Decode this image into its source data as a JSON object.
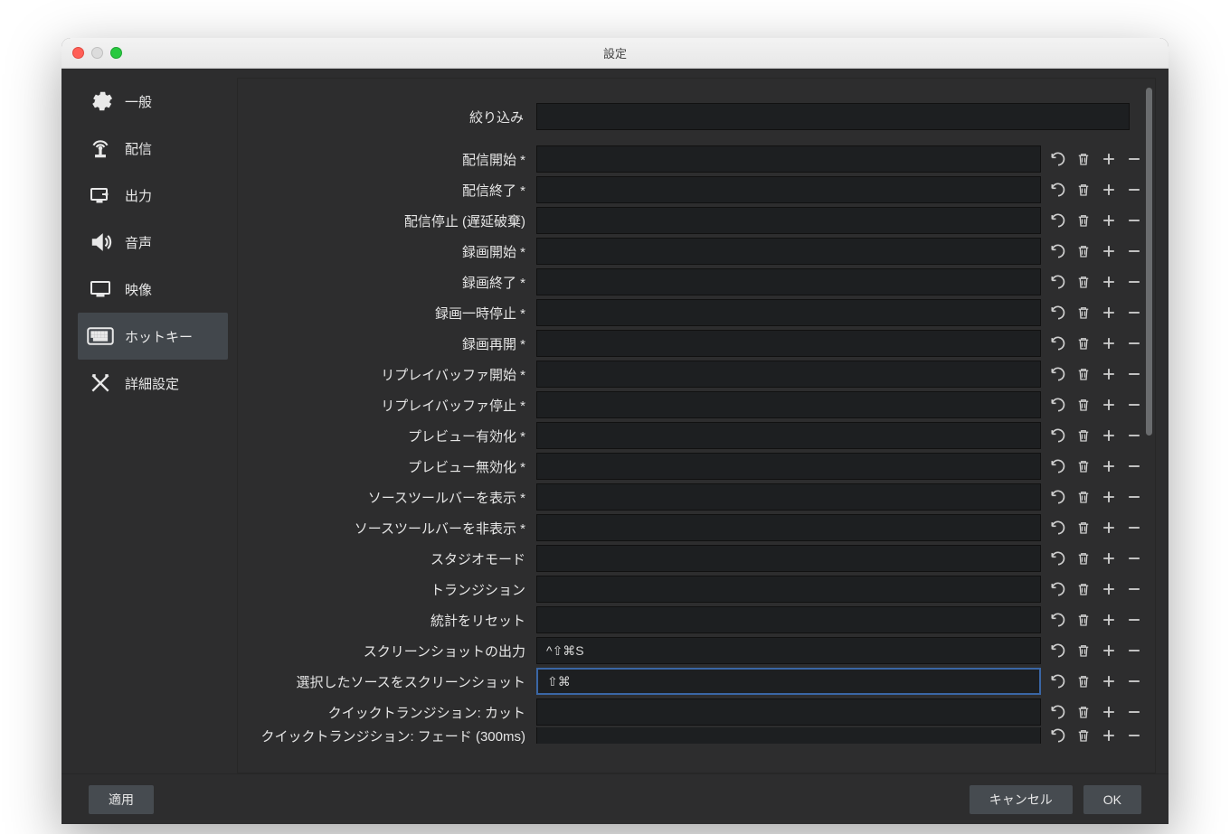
{
  "window": {
    "title": "設定"
  },
  "sidebar": {
    "items": [
      {
        "id": "general",
        "label": "一般"
      },
      {
        "id": "stream",
        "label": "配信"
      },
      {
        "id": "output",
        "label": "出力"
      },
      {
        "id": "audio",
        "label": "音声"
      },
      {
        "id": "video",
        "label": "映像"
      },
      {
        "id": "hotkeys",
        "label": "ホットキー",
        "selected": true
      },
      {
        "id": "advanced",
        "label": "詳細設定"
      }
    ]
  },
  "filter": {
    "label": "絞り込み",
    "value": ""
  },
  "hotkeys": [
    {
      "label": "配信開始 *",
      "value": ""
    },
    {
      "label": "配信終了 *",
      "value": ""
    },
    {
      "label": "配信停止 (遅延破棄)",
      "value": ""
    },
    {
      "label": "録画開始 *",
      "value": ""
    },
    {
      "label": "録画終了 *",
      "value": ""
    },
    {
      "label": "録画一時停止 *",
      "value": ""
    },
    {
      "label": "録画再開 *",
      "value": ""
    },
    {
      "label": "リプレイバッファ開始 *",
      "value": ""
    },
    {
      "label": "リプレイバッファ停止 *",
      "value": ""
    },
    {
      "label": "プレビュー有効化 *",
      "value": ""
    },
    {
      "label": "プレビュー無効化 *",
      "value": ""
    },
    {
      "label": "ソースツールバーを表示 *",
      "value": ""
    },
    {
      "label": "ソースツールバーを非表示 *",
      "value": ""
    },
    {
      "label": "スタジオモード",
      "value": ""
    },
    {
      "label": "トランジション",
      "value": ""
    },
    {
      "label": "統計をリセット",
      "value": ""
    },
    {
      "label": "スクリーンショットの出力",
      "value": "^⇧⌘S"
    },
    {
      "label": "選択したソースをスクリーンショット",
      "value": "⇧⌘",
      "focused": true
    },
    {
      "label": "クイックトランジション: カット",
      "value": ""
    },
    {
      "label": "クイックトランジション: フェード (300ms)",
      "value": "",
      "cutoff": true
    }
  ],
  "footer": {
    "apply": "適用",
    "cancel": "キャンセル",
    "ok": "OK"
  },
  "icons": {
    "undo": "undo-icon",
    "trash": "trash-icon",
    "plus": "plus-icon",
    "minus": "minus-icon"
  }
}
